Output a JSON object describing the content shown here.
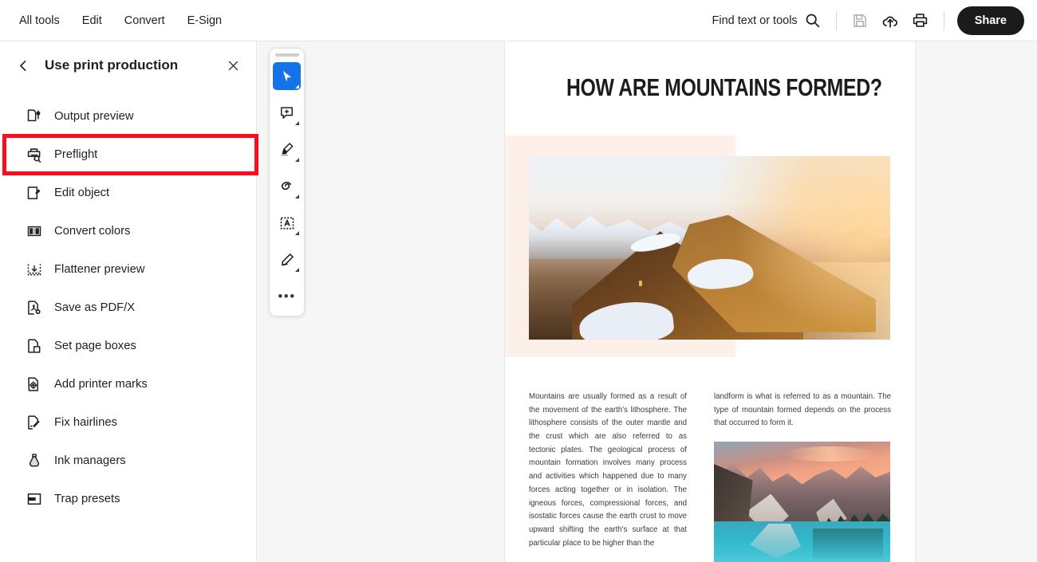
{
  "topbar": {
    "nav": [
      {
        "label": "All tools"
      },
      {
        "label": "Edit"
      },
      {
        "label": "Convert"
      },
      {
        "label": "E-Sign"
      }
    ],
    "find_label": "Find text or tools",
    "icons": [
      {
        "name": "search-icon"
      },
      {
        "name": "save-icon"
      },
      {
        "name": "cloud-upload-icon"
      },
      {
        "name": "print-icon"
      }
    ],
    "share_label": "Share"
  },
  "sidebar": {
    "title": "Use print production",
    "back_icon": "chevron-left-icon",
    "close_icon": "close-icon",
    "items": [
      {
        "label": "Output preview",
        "icon": "output-preview-icon"
      },
      {
        "label": "Preflight",
        "icon": "preflight-icon",
        "highlighted": true
      },
      {
        "label": "Edit object",
        "icon": "edit-object-icon"
      },
      {
        "label": "Convert colors",
        "icon": "convert-colors-icon"
      },
      {
        "label": "Flattener preview",
        "icon": "flattener-preview-icon"
      },
      {
        "label": "Save as PDF/X",
        "icon": "save-pdfx-icon"
      },
      {
        "label": "Set page boxes",
        "icon": "set-page-boxes-icon"
      },
      {
        "label": "Add printer marks",
        "icon": "add-printer-marks-icon"
      },
      {
        "label": "Fix hairlines",
        "icon": "fix-hairlines-icon"
      },
      {
        "label": "Ink managers",
        "icon": "ink-managers-icon"
      },
      {
        "label": "Trap presets",
        "icon": "trap-presets-icon"
      }
    ],
    "highlight_color": "#fc0d1b"
  },
  "quick_toolbar": {
    "tools": [
      {
        "name": "select-cursor-tool",
        "active": true
      },
      {
        "name": "add-comment-tool",
        "active": false
      },
      {
        "name": "highlight-tool",
        "active": false
      },
      {
        "name": "draw-freeform-tool",
        "active": false
      },
      {
        "name": "add-text-box-tool",
        "active": false
      },
      {
        "name": "fill-and-sign-tool",
        "active": false
      },
      {
        "name": "more-tools",
        "active": false,
        "label": "•••"
      }
    ],
    "active_color": "#1473e6"
  },
  "document": {
    "title": "HOW ARE MOUNTAINS FORMED?",
    "accent_block_color": "#fcf0e9",
    "body_left": "Mountains are usually formed as a result of the movement of the earth's lithosphere. The lithosphere consists of the outer mantle and the crust which are also referred to as tectonic plates. The geological process of mountain formation involves many process and activities which happened due to many forces acting together or in isolation. The igneous forces, compressional forces, and isostatic forces cause the earth crust to move upward shifting the earth's surface at that particular place to be higher than the",
    "body_right": "landform is what is referred to as a mountain. The type of mountain formed depends on the process that occurred to form it.",
    "image_1_alt": "sunset-mountain-ridge-photo",
    "image_2_alt": "moraine-lake-mountains-photo"
  }
}
